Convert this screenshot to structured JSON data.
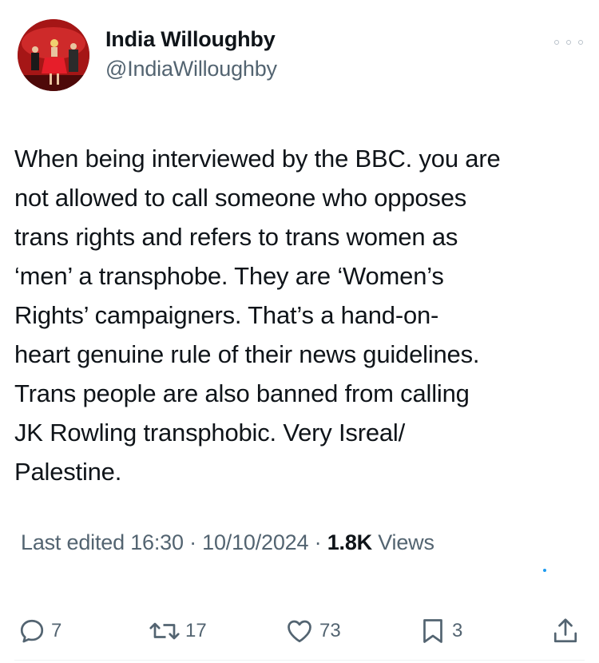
{
  "author": {
    "display_name": "India Willoughby",
    "handle": "@IndiaWilloughby"
  },
  "tweet": {
    "lines": [
      "When being interviewed by the BBC. you are",
      "not allowed to call someone who opposes",
      "trans rights and refers to trans women as",
      "‘men’ a transphobe. They are ‘Women’s",
      "Rights’ campaigners. That’s a hand-on-",
      "heart genuine rule of their news guidelines.",
      "Trans people are also banned from calling",
      "JK Rowling transphobic. Very Isreal/",
      "Palestine."
    ]
  },
  "meta": {
    "edited_label": "Last edited 16:30 · 10/10/2024",
    "separator": " · ",
    "views_count": "1.8K",
    "views_label": " Views"
  },
  "actions": {
    "replies": "7",
    "reposts": "17",
    "likes": "73",
    "bookmarks": "3"
  },
  "icons": {
    "more": "more-horizontal-icon",
    "reply": "reply-icon",
    "repost": "repost-icon",
    "like": "heart-icon",
    "bookmark": "bookmark-icon",
    "share": "share-icon"
  },
  "colors": {
    "text": "#0f1419",
    "secondary": "#536471",
    "accent": "#1d9bf0"
  }
}
